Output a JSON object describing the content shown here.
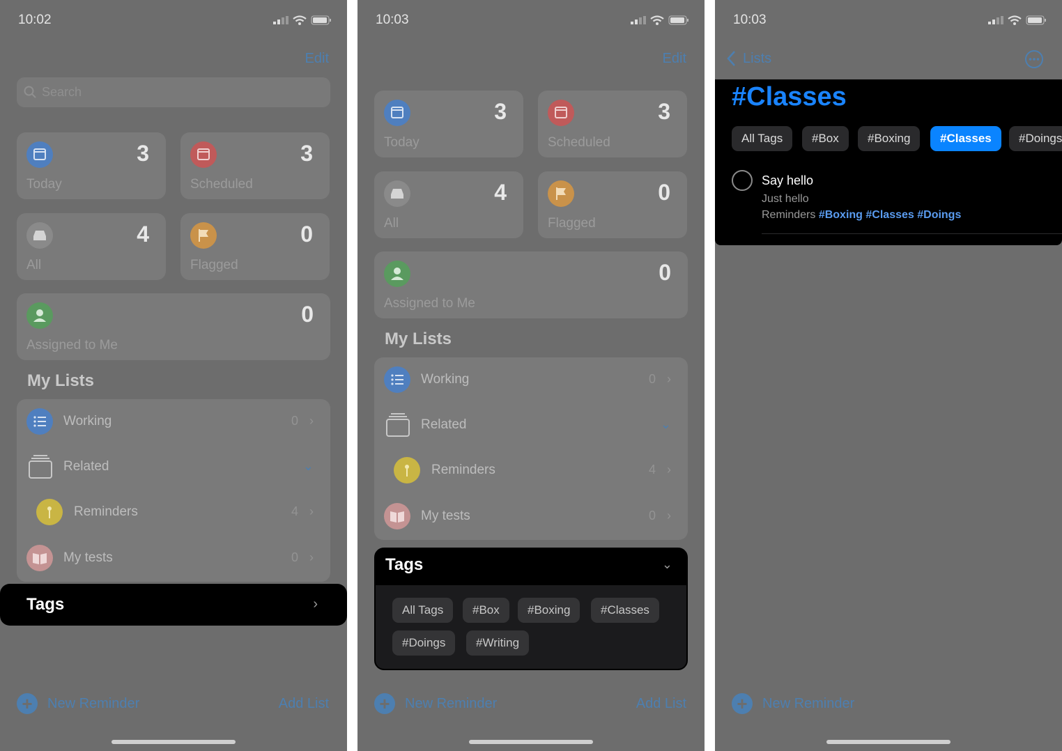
{
  "panel1": {
    "time": "10:02",
    "edit": "Edit",
    "search_placeholder": "Search",
    "cards": [
      {
        "name": "Today",
        "count": "3"
      },
      {
        "name": "Scheduled",
        "count": "3"
      },
      {
        "name": "All",
        "count": "4"
      },
      {
        "name": "Flagged",
        "count": "0"
      },
      {
        "name": "Assigned to Me",
        "count": "0"
      }
    ],
    "my_lists_heading": "My Lists",
    "lists": [
      {
        "name": "Working",
        "count": "0"
      },
      {
        "name": "Related"
      },
      {
        "name": "Reminders",
        "count": "4"
      },
      {
        "name": "My tests",
        "count": "0"
      }
    ],
    "tags_label": "Tags",
    "new_reminder": "New Reminder",
    "add_list": "Add List"
  },
  "panel2": {
    "time": "10:03",
    "edit": "Edit",
    "cards": [
      {
        "name": "Today",
        "count": "3"
      },
      {
        "name": "Scheduled",
        "count": "3"
      },
      {
        "name": "All",
        "count": "4"
      },
      {
        "name": "Flagged",
        "count": "0"
      },
      {
        "name": "Assigned to Me",
        "count": "0"
      }
    ],
    "my_lists_heading": "My Lists",
    "lists": [
      {
        "name": "Working",
        "count": "0"
      },
      {
        "name": "Related"
      },
      {
        "name": "Reminders",
        "count": "4"
      },
      {
        "name": "My tests",
        "count": "0"
      }
    ],
    "tags_label": "Tags",
    "tags": [
      "All Tags",
      "#Box",
      "#Boxing",
      "#Classes",
      "#Doings",
      "#Writing"
    ],
    "new_reminder": "New Reminder",
    "add_list": "Add List"
  },
  "panel3": {
    "time": "10:03",
    "back_label": "Lists",
    "title": "#Classes",
    "tags": [
      "All Tags",
      "#Box",
      "#Boxing",
      "#Classes",
      "#Doings"
    ],
    "selected_tag": "#Classes",
    "reminder": {
      "title": "Say hello",
      "note": "Just hello",
      "list": "Reminders",
      "tags": [
        "#Boxing",
        "#Classes",
        "#Doings"
      ]
    },
    "new_reminder": "New Reminder"
  },
  "colors": {
    "accent": "#0a84ff",
    "dimmed_accent": "#4d7fb0",
    "today": "#4f7fbf",
    "scheduled": "#c05a5a",
    "all": "#8a8a8a",
    "flagged": "#c9924a",
    "assigned": "#5a9a5f"
  }
}
